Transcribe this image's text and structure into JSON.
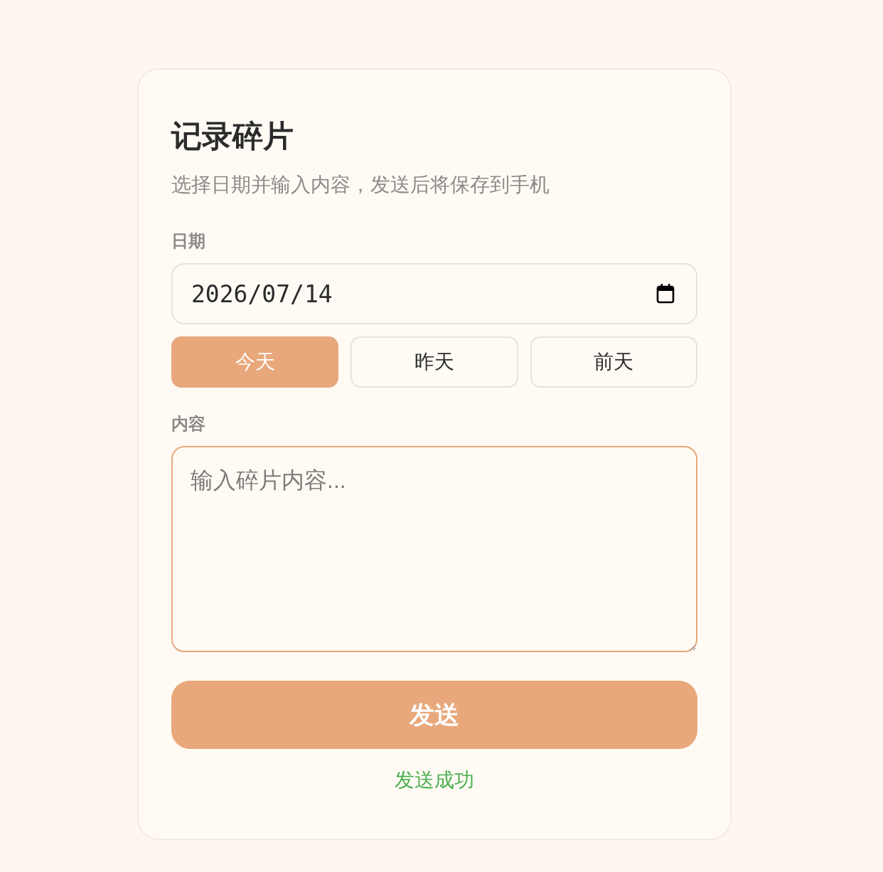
{
  "card": {
    "title": "记录碎片",
    "subtitle": "选择日期并输入内容，发送后将保存到手机"
  },
  "date": {
    "label": "日期",
    "value": "2026/07/14"
  },
  "quick_dates": [
    {
      "label": "今天",
      "selected": true
    },
    {
      "label": "昨天",
      "selected": false
    },
    {
      "label": "前天",
      "selected": false
    }
  ],
  "content": {
    "label": "内容",
    "placeholder": "输入碎片内容...",
    "focused": true
  },
  "send_button": {
    "label": "发送"
  },
  "status": {
    "text": "发送成功",
    "kind": "success"
  }
}
